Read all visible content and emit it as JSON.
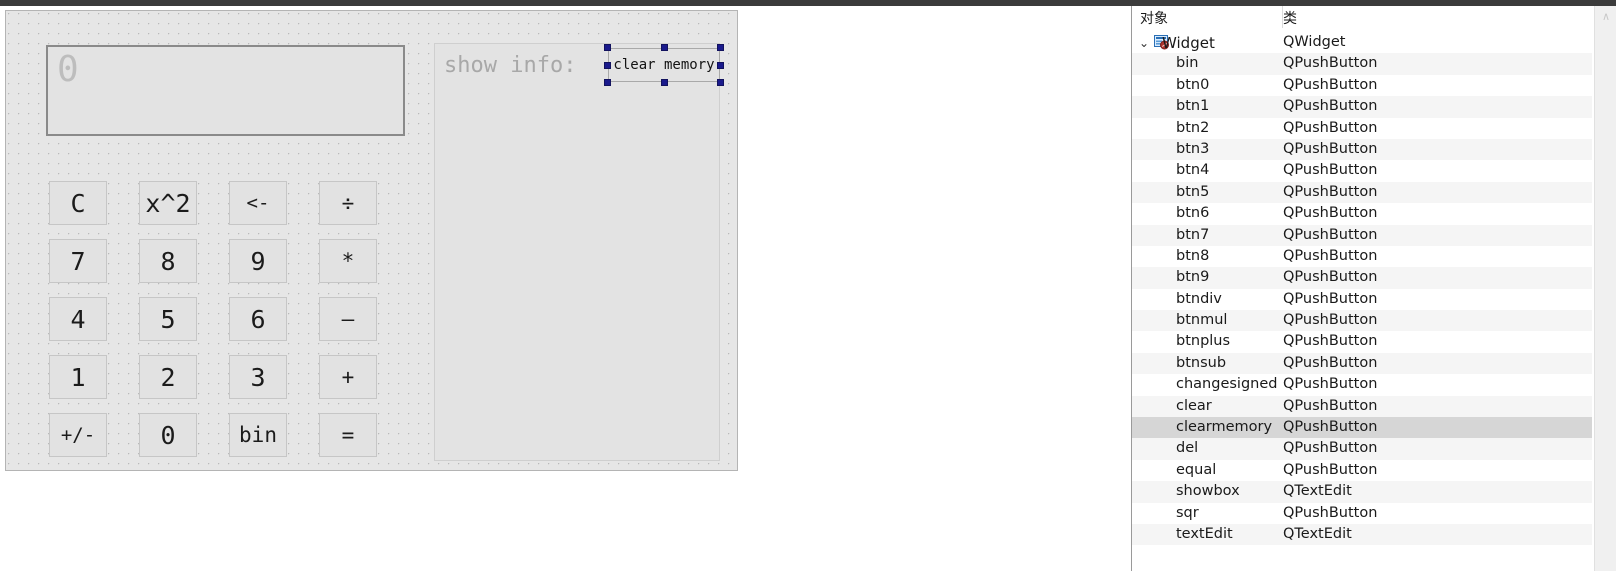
{
  "designer": {
    "form": {
      "text_edit": {
        "value": "0"
      },
      "show_box": {
        "placeholder": "show info:"
      },
      "selected_button": {
        "label": "clear memory",
        "name": "clearmemory"
      }
    },
    "keypad": {
      "rows": [
        [
          {
            "label": "C"
          },
          {
            "label": "x^2"
          },
          {
            "label": "<-"
          },
          {
            "label": "÷"
          }
        ],
        [
          {
            "label": "7"
          },
          {
            "label": "8"
          },
          {
            "label": "9"
          },
          {
            "label": "*"
          }
        ],
        [
          {
            "label": "4"
          },
          {
            "label": "5"
          },
          {
            "label": "6"
          },
          {
            "label": "—"
          }
        ],
        [
          {
            "label": "1"
          },
          {
            "label": "2"
          },
          {
            "label": "3"
          },
          {
            "label": "+"
          }
        ],
        [
          {
            "label": "+/-"
          },
          {
            "label": "0"
          },
          {
            "label": "bin"
          },
          {
            "label": "="
          }
        ]
      ]
    }
  },
  "inspector": {
    "headers": {
      "object": "对象",
      "class": "类"
    },
    "rows": [
      {
        "name": "Widget",
        "class": "QWidget",
        "root": true,
        "selected": false
      },
      {
        "name": "bin",
        "class": "QPushButton",
        "selected": false
      },
      {
        "name": "btn0",
        "class": "QPushButton",
        "selected": false
      },
      {
        "name": "btn1",
        "class": "QPushButton",
        "selected": false
      },
      {
        "name": "btn2",
        "class": "QPushButton",
        "selected": false
      },
      {
        "name": "btn3",
        "class": "QPushButton",
        "selected": false
      },
      {
        "name": "btn4",
        "class": "QPushButton",
        "selected": false
      },
      {
        "name": "btn5",
        "class": "QPushButton",
        "selected": false
      },
      {
        "name": "btn6",
        "class": "QPushButton",
        "selected": false
      },
      {
        "name": "btn7",
        "class": "QPushButton",
        "selected": false
      },
      {
        "name": "btn8",
        "class": "QPushButton",
        "selected": false
      },
      {
        "name": "btn9",
        "class": "QPushButton",
        "selected": false
      },
      {
        "name": "btndiv",
        "class": "QPushButton",
        "selected": false
      },
      {
        "name": "btnmul",
        "class": "QPushButton",
        "selected": false
      },
      {
        "name": "btnplus",
        "class": "QPushButton",
        "selected": false
      },
      {
        "name": "btnsub",
        "class": "QPushButton",
        "selected": false
      },
      {
        "name": "changesigned",
        "class": "QPushButton",
        "selected": false
      },
      {
        "name": "clear",
        "class": "QPushButton",
        "selected": false
      },
      {
        "name": "clearmemory",
        "class": "QPushButton",
        "selected": true
      },
      {
        "name": "del",
        "class": "QPushButton",
        "selected": false
      },
      {
        "name": "equal",
        "class": "QPushButton",
        "selected": false
      },
      {
        "name": "showbox",
        "class": "QTextEdit",
        "selected": false
      },
      {
        "name": "sqr",
        "class": "QPushButton",
        "selected": false
      },
      {
        "name": "textEdit",
        "class": "QTextEdit",
        "selected": false
      }
    ],
    "scrollbar": {
      "up_arrow": "∧"
    },
    "expand_chevron": "⌄"
  },
  "colors": {
    "selection_handle": "#1a1a8c",
    "row_selected": "#d6d6d6",
    "row_alt": "#f5f5f5",
    "canvas": "#e6e6e6"
  }
}
